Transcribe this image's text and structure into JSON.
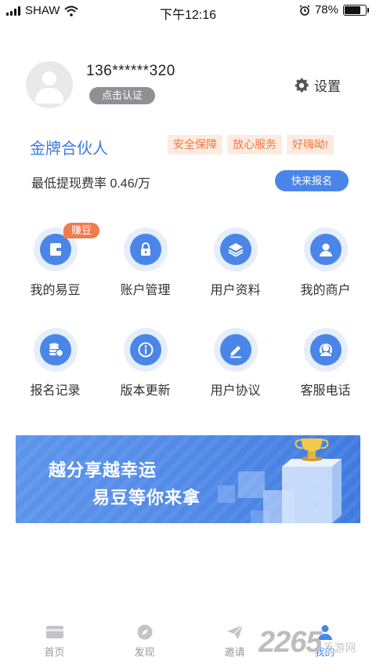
{
  "status_bar": {
    "carrier": "SHAW",
    "time": "下午12:16",
    "battery": "78%",
    "battery_level": 0.78
  },
  "profile": {
    "phone": "136******320",
    "verify_label": "点击认证",
    "settings_label": "设置"
  },
  "partner": {
    "title": "金牌合伙人",
    "tags": [
      "安全保障",
      "放心服务",
      "好嗨呦!"
    ],
    "rate_text": "最低提现费率 0.46/万",
    "signup_label": "快来报名"
  },
  "menu": [
    {
      "label": "我的易豆",
      "icon": "wallet-icon",
      "badge": "赚豆"
    },
    {
      "label": "账户管理",
      "icon": "lock-icon"
    },
    {
      "label": "用户资料",
      "icon": "layers-icon"
    },
    {
      "label": "我的商户",
      "icon": "user-icon"
    },
    {
      "label": "报名记录",
      "icon": "coins-icon"
    },
    {
      "label": "版本更新",
      "icon": "info-icon"
    },
    {
      "label": "用户协议",
      "icon": "pen-icon"
    },
    {
      "label": "客服电话",
      "icon": "headset-icon"
    }
  ],
  "banner": {
    "line1": "越分享越幸运",
    "line2": "易豆等你来拿"
  },
  "tabs": [
    {
      "label": "首页",
      "icon": "card-icon"
    },
    {
      "label": "发现",
      "icon": "compass-icon"
    },
    {
      "label": "邀请",
      "icon": "paper-plane-icon"
    },
    {
      "label": "我的",
      "icon": "profile-icon",
      "active": true
    }
  ],
  "watermark": {
    "number": "2265",
    "text": "手游网"
  },
  "colors": {
    "accent": "#4a86e8",
    "tag_bg": "#fdebe2",
    "tag_text": "#f0793c",
    "badge": "#f27a4e"
  }
}
